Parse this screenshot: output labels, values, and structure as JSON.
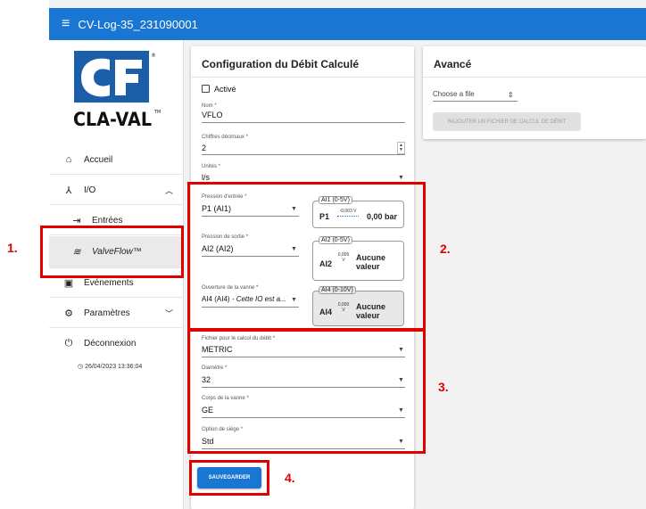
{
  "app": {
    "title": "CV-Log-35_231090001"
  },
  "logo": {
    "text": "CLA-VAL",
    "trademark": "TM",
    "registered": "®"
  },
  "sidebar": {
    "items": [
      {
        "label": "Accueil",
        "icon": "home-icon"
      },
      {
        "label": "I/O",
        "icon": "io-icon"
      },
      {
        "label": "Entrées",
        "icon": "input-arrow-icon"
      },
      {
        "label": "ValveFlow™",
        "icon": "waves-icon"
      },
      {
        "label": "Événements",
        "icon": "event-icon"
      },
      {
        "label": "Paramètres",
        "icon": "settings-icon"
      },
      {
        "label": "Déconnexion",
        "icon": "power-icon"
      }
    ],
    "timestamp": "26/04/2023 13:36:04"
  },
  "config": {
    "title": "Configuration du Débit Calculé",
    "active_label": "Activé",
    "name_label": "Nom *",
    "name_value": "VFLO",
    "decimals_label": "Chiffres décimaux *",
    "decimals_value": "2",
    "units_label": "Unités *",
    "units_value": "l/s",
    "inlet_label": "Pression d'entrée *",
    "inlet_value": "P1 (AI1)",
    "outlet_label": "Pression de sortie *",
    "outlet_value": "AI2 (AI2)",
    "opening_label": "Ouverture de la vanne *",
    "opening_value": "AI4 (AI4)",
    "opening_note": "- Cette IO est a...",
    "file_label": "Fichier pour le calcul du débit *",
    "file_value": "METRIC",
    "diameter_label": "Diamètre *",
    "diameter_value": "32",
    "body_label": "Corps de la vanne *",
    "body_value": "GE",
    "seat_label": "Option de siège *",
    "seat_value": "Std",
    "save_label": "SAUVEGARDER"
  },
  "sensors": [
    {
      "legend": "AI1 (0-5V)",
      "name": "P1",
      "raw": "-0,003 V",
      "value": "0,00 bar"
    },
    {
      "legend": "AI2 (0-5V)",
      "name": "AI2",
      "raw_top": "0,005",
      "raw_bottom": "V",
      "value_line1": "Aucune",
      "value_line2": "valeur"
    },
    {
      "legend": "AI4 (0-10V)",
      "name": "AI4",
      "raw_top": "0,000",
      "raw_bottom": "V",
      "value_line1": "Aucune",
      "value_line2": "valeur"
    }
  ],
  "advanced": {
    "title": "Avancé",
    "choose_file": "Choose a file",
    "add_button": "RAJOUTER UN FICHIER DE CALCUL DE DÉBIT"
  },
  "callouts": [
    "1.",
    "2.",
    "3.",
    "4."
  ],
  "colors": {
    "appbar": "#1976d2",
    "highlight": "#e00000"
  }
}
